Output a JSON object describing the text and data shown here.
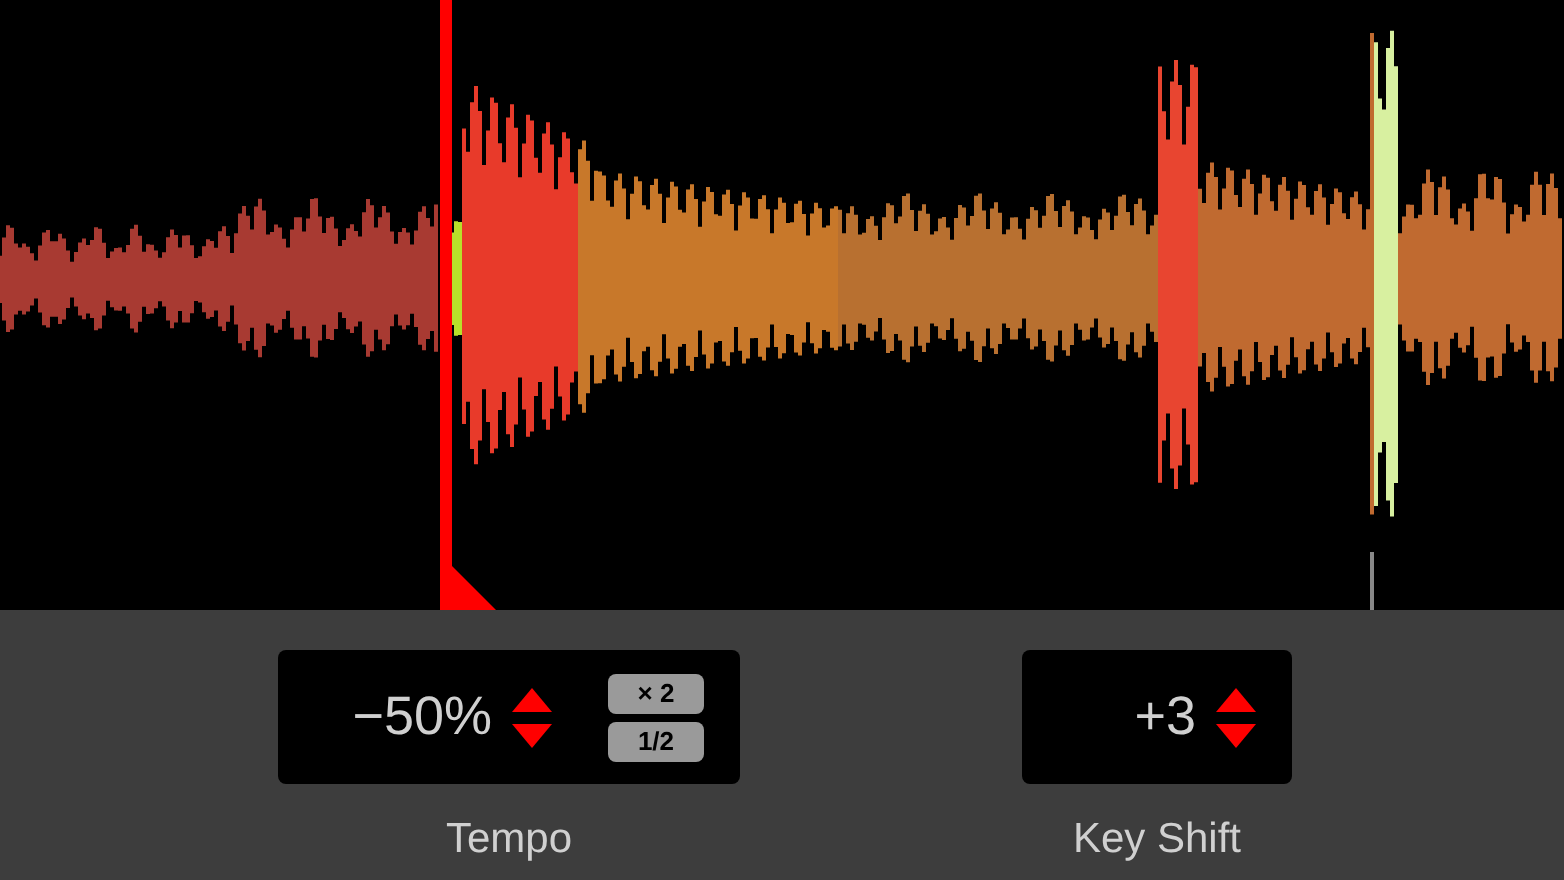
{
  "tempo": {
    "value": "−50%",
    "multipliers": [
      "× 2",
      "1/2"
    ],
    "label": "Tempo"
  },
  "key_shift": {
    "value": "+3",
    "label": "Key Shift"
  }
}
